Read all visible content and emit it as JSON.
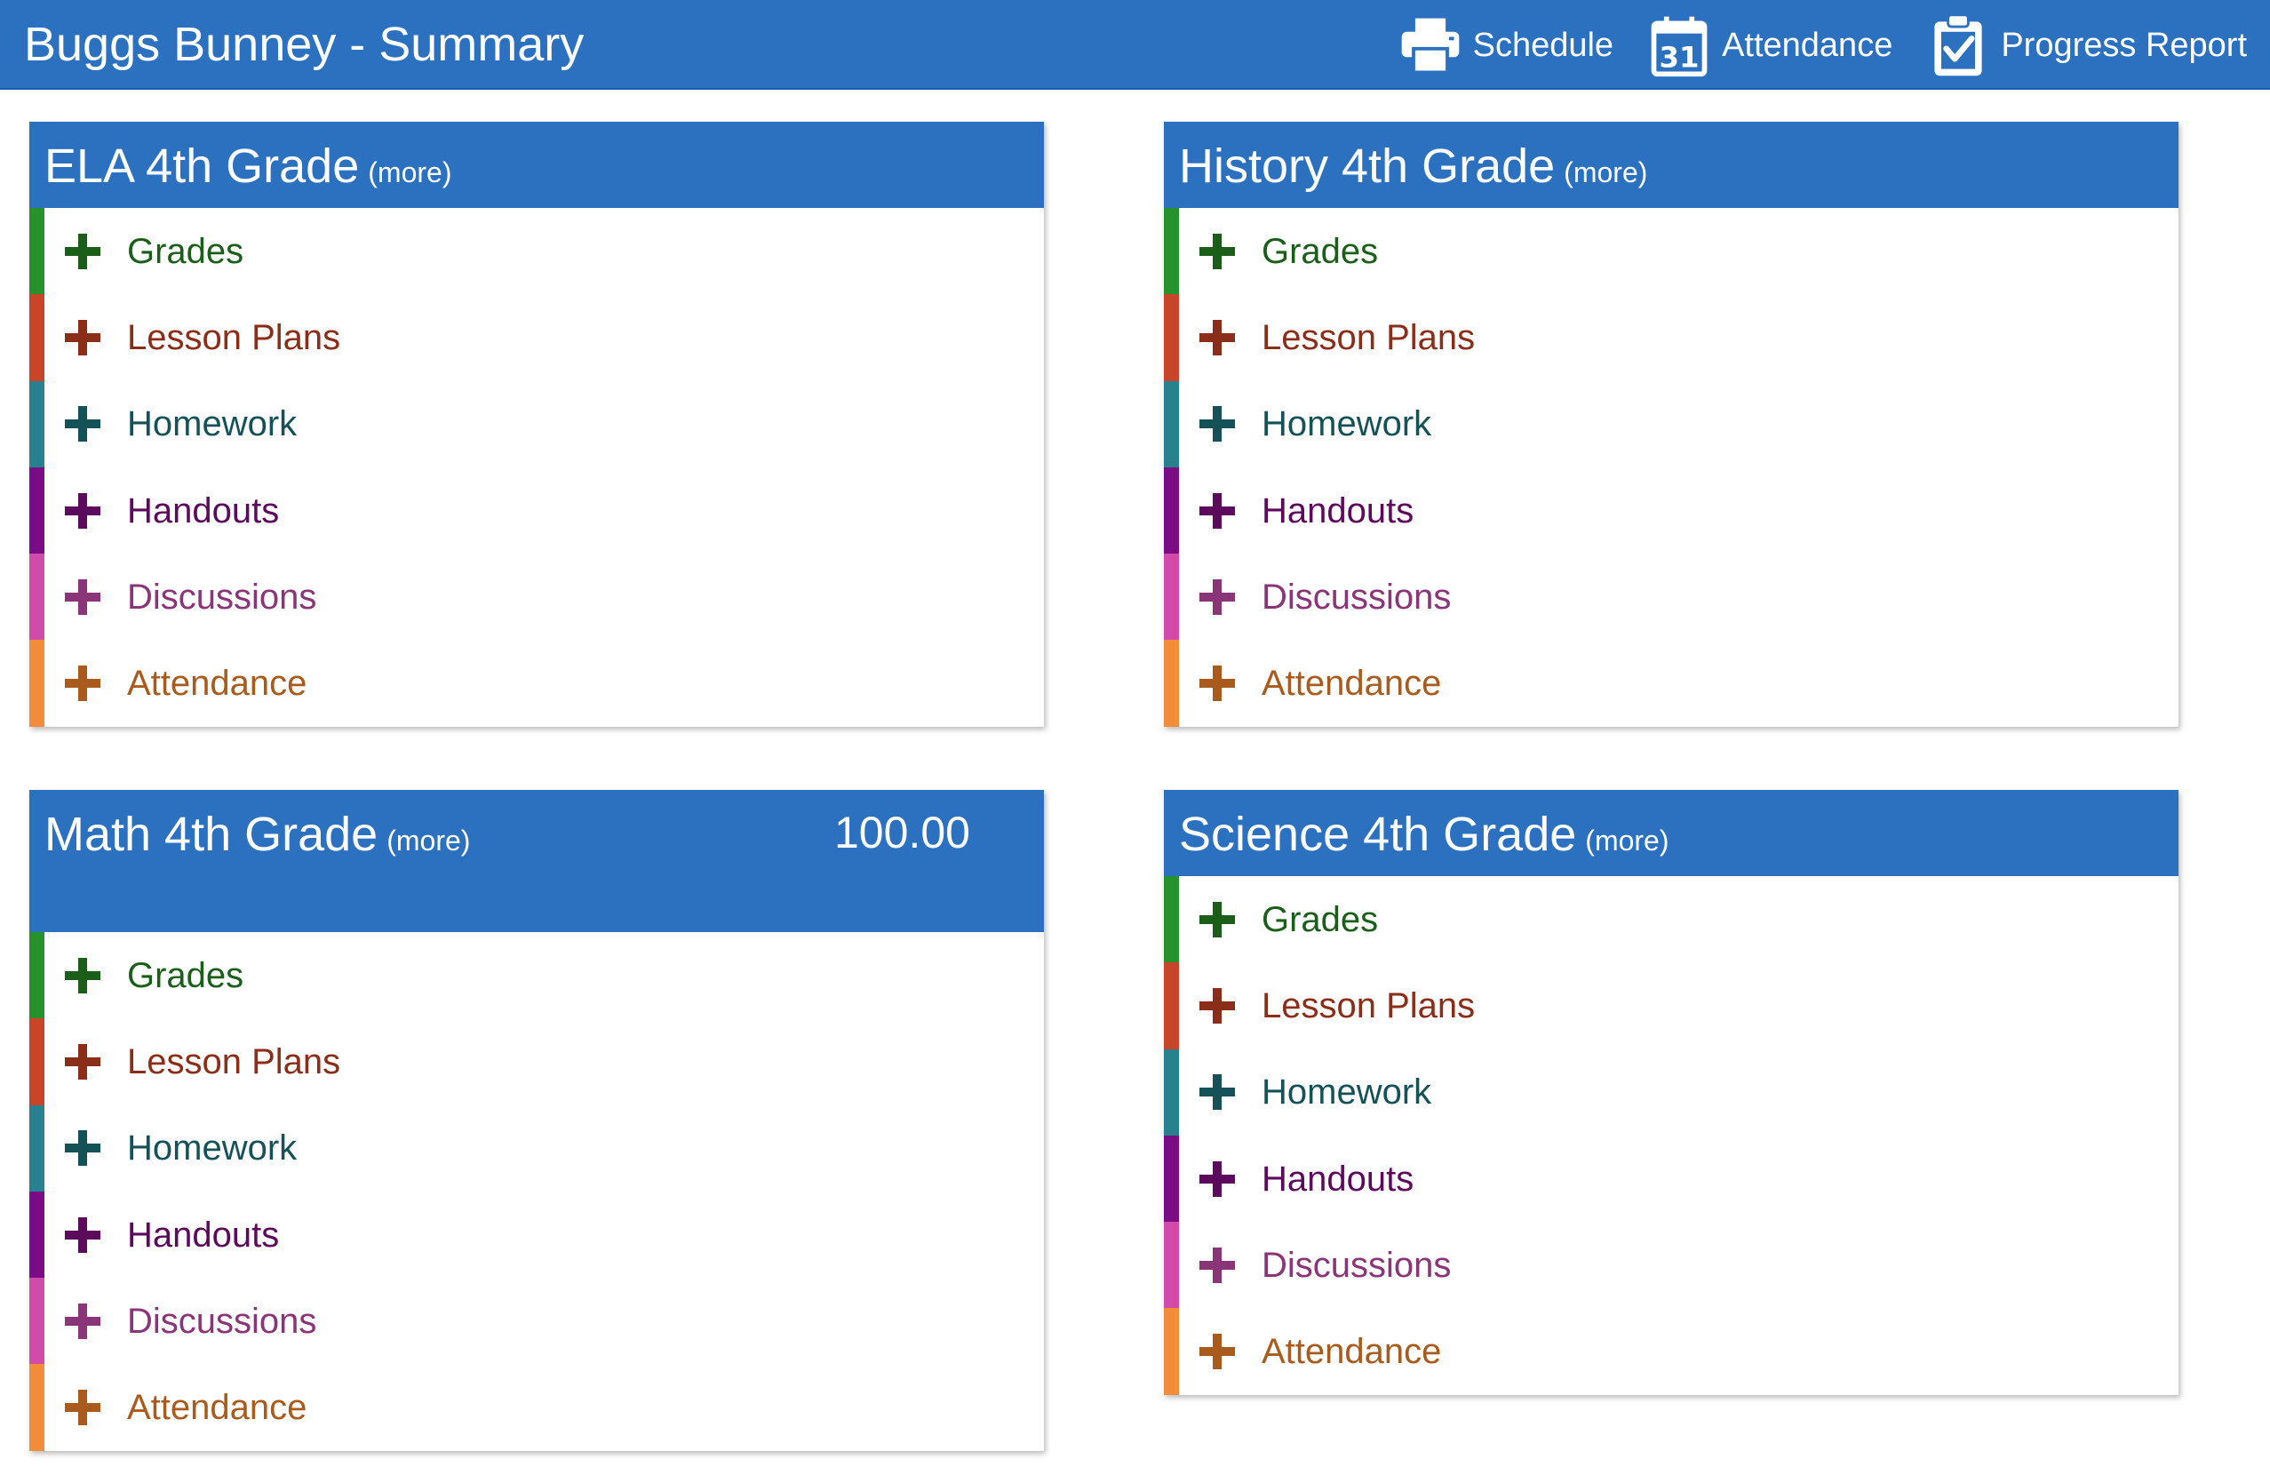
{
  "header": {
    "title": "Buggs Bunney - Summary",
    "links": [
      {
        "label": "Schedule",
        "icon": "printer-icon"
      },
      {
        "label": "Attendance",
        "icon": "calendar-icon"
      },
      {
        "label": "Progress Report",
        "icon": "clipboard-check-icon"
      }
    ]
  },
  "colors": {
    "header_bg": "#2b71c0",
    "grades": "#26922c",
    "lesson_plans": "#c9452a",
    "homework": "#27818e",
    "handouts": "#7a0d85",
    "discussions": "#d34ba8",
    "attendance": "#f08c3a"
  },
  "cards": [
    {
      "title": "ELA 4th Grade",
      "more": "(more)",
      "score": "",
      "items": [
        "Grades",
        "Lesson Plans",
        "Homework",
        "Handouts",
        "Discussions",
        "Attendance"
      ]
    },
    {
      "title": "History 4th Grade",
      "more": "(more)",
      "score": "",
      "items": [
        "Grades",
        "Lesson Plans",
        "Homework",
        "Handouts",
        "Discussions",
        "Attendance"
      ]
    },
    {
      "title": "Math 4th Grade",
      "more": "(more)",
      "score": "100.00",
      "items": [
        "Grades",
        "Lesson Plans",
        "Homework",
        "Handouts",
        "Discussions",
        "Attendance"
      ]
    },
    {
      "title": "Science 4th Grade",
      "more": "(more)",
      "score": "",
      "items": [
        "Grades",
        "Lesson Plans",
        "Homework",
        "Handouts",
        "Discussions",
        "Attendance"
      ]
    }
  ]
}
